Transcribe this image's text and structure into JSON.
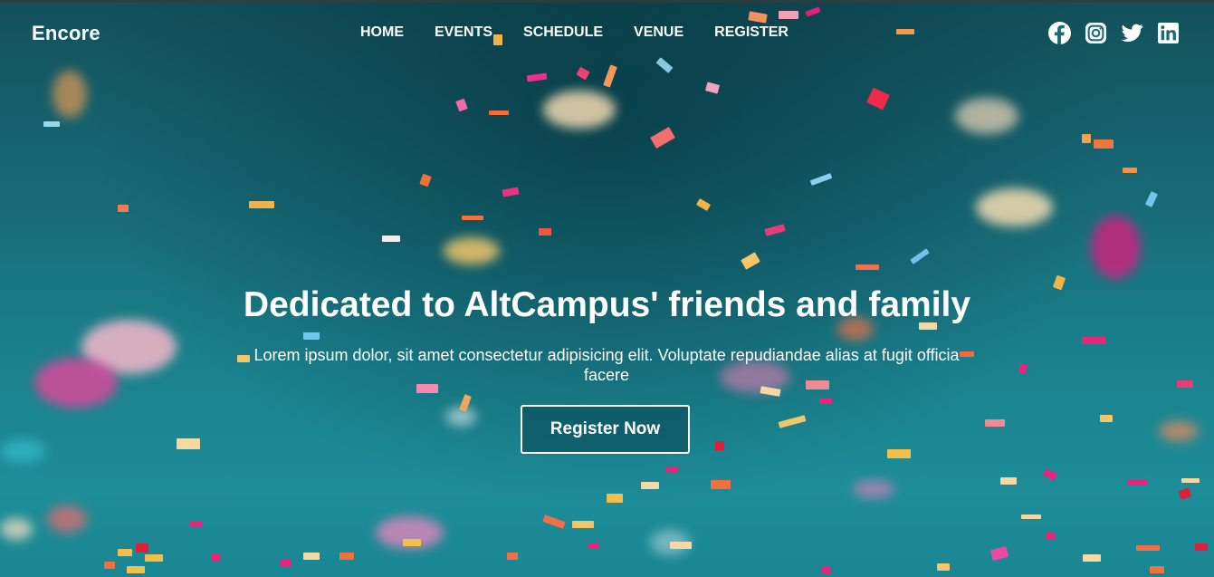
{
  "brand": {
    "name": "Encore"
  },
  "nav": {
    "items": [
      {
        "label": "HOME"
      },
      {
        "label": "EVENTS"
      },
      {
        "label": "SCHEDULE"
      },
      {
        "label": "VENUE"
      },
      {
        "label": "REGISTER"
      }
    ]
  },
  "social": {
    "icons": [
      "facebook-icon",
      "instagram-icon",
      "twitter-icon",
      "linkedin-icon"
    ]
  },
  "hero": {
    "title": "Dedicated to AltCampus' friends and family",
    "subtitle": "Lorem ipsum dolor, sit amet consectetur adipisicing elit. Voluptate repudiandae alias at fugit officia facere",
    "cta_label": "Register Now"
  },
  "colors": {
    "background_top": "#13505a",
    "background_bottom": "#1d8d99",
    "text": "#ffffff"
  }
}
